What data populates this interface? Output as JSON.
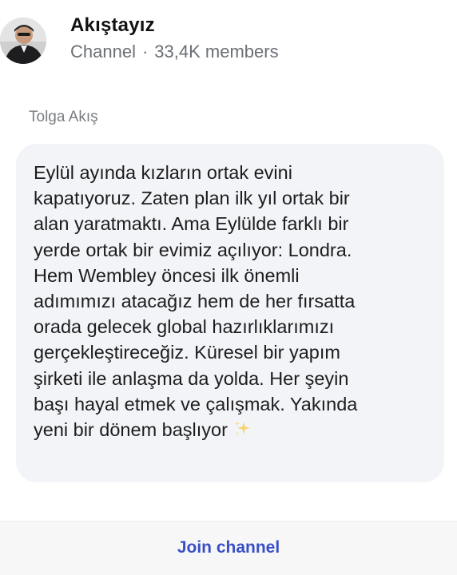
{
  "header": {
    "channel_name": "Akıştayız",
    "channel_type": "Channel",
    "separator": "·",
    "member_count": "33,4K members",
    "avatar_icon": "profile-photo"
  },
  "post": {
    "sender": "Tolga Akış",
    "lines": [
      "Eylül ayında kızların ortak evini",
      "kapatıyoruz. Zaten plan ilk yıl ortak bir",
      "alan yaratmaktı. Ama Eylülde farklı bir",
      "yerde ortak bir evimiz açılıyor: Londra.",
      "Hem Wembley öncesi ilk önemli",
      "adımımızı atacağız hem de her fırsatta",
      "orada gelecek global hazırlıklarımızı",
      "gerçekleştireceğiz. Küresel bir yapım",
      "şirketi ile anlaşma da yolda. Her şeyin",
      "başı hayal etmek ve çalışmak. Yakında",
      "yeni bir dönem başlıyor"
    ],
    "emoji": "sparkles-icon",
    "bubble_color": "#f3f4f7"
  },
  "footer": {
    "join_label": "Join channel",
    "join_color": "#3a4fc4"
  }
}
